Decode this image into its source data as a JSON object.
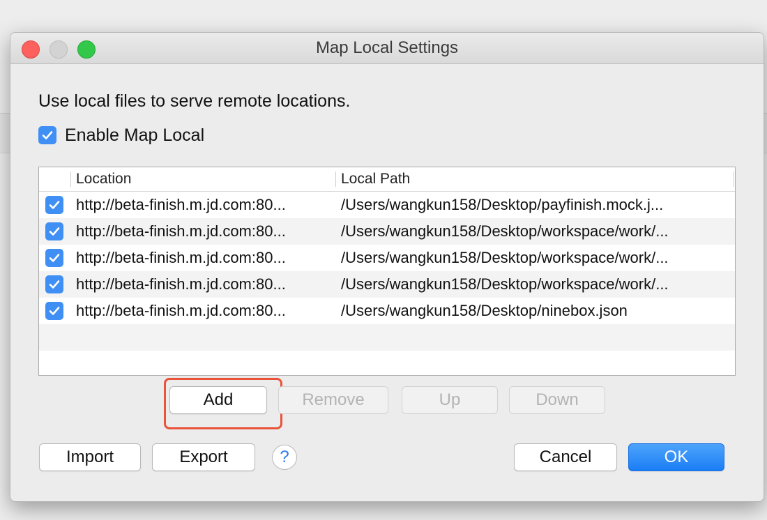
{
  "window": {
    "title": "Map Local Settings"
  },
  "description": "Use local files to serve remote locations.",
  "enable": {
    "label": "Enable Map Local",
    "checked": true
  },
  "table": {
    "columns": [
      "Location",
      "Local Path"
    ],
    "rows": [
      {
        "checked": true,
        "location": "http://beta-finish.m.jd.com:80...",
        "path": "/Users/wangkun158/Desktop/payfinish.mock.j..."
      },
      {
        "checked": true,
        "location": "http://beta-finish.m.jd.com:80...",
        "path": "/Users/wangkun158/Desktop/workspace/work/..."
      },
      {
        "checked": true,
        "location": "http://beta-finish.m.jd.com:80...",
        "path": "/Users/wangkun158/Desktop/workspace/work/..."
      },
      {
        "checked": true,
        "location": "http://beta-finish.m.jd.com:80...",
        "path": "/Users/wangkun158/Desktop/workspace/work/..."
      },
      {
        "checked": true,
        "location": "http://beta-finish.m.jd.com:80...",
        "path": "/Users/wangkun158/Desktop/ninebox.json"
      }
    ]
  },
  "row_buttons": {
    "add": "Add",
    "remove": "Remove",
    "up": "Up",
    "down": "Down"
  },
  "footer": {
    "import": "Import",
    "export": "Export",
    "help": "?",
    "cancel": "Cancel",
    "ok": "OK"
  },
  "colors": {
    "accent": "#3f8ff5",
    "highlight": "#e8533a",
    "primary": "#1a7df5"
  }
}
